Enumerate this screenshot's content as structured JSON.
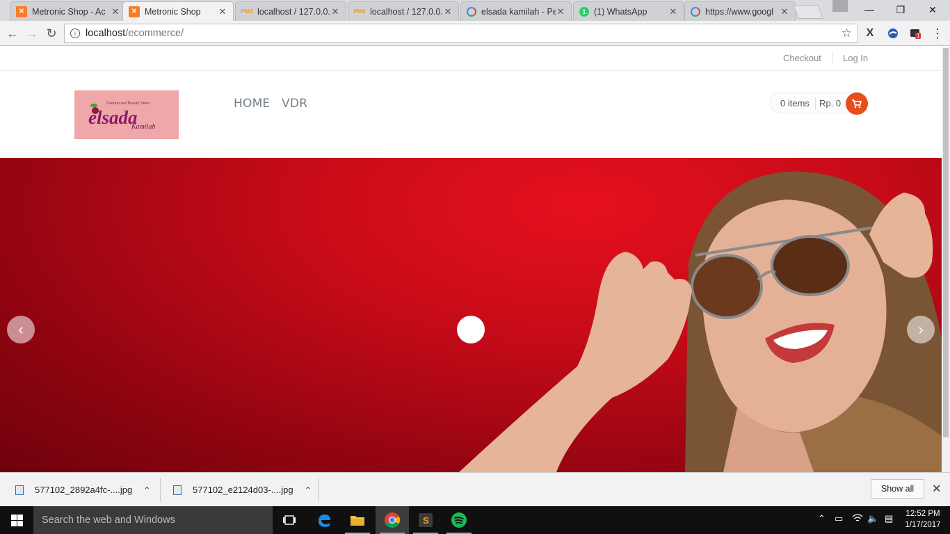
{
  "browser": {
    "tabs": [
      {
        "title": "Metronic Shop - Ac",
        "favicon": "xampp-icon",
        "active": false
      },
      {
        "title": "Metronic Shop",
        "favicon": "xampp-icon",
        "active": true
      },
      {
        "title": "localhost / 127.0.0.",
        "favicon": "phpmyadmin-icon",
        "active": false
      },
      {
        "title": "localhost / 127.0.0.",
        "favicon": "phpmyadmin-icon",
        "active": false
      },
      {
        "title": "elsada kamilah - Pe",
        "favicon": "google-icon",
        "active": false
      },
      {
        "title": "(1) WhatsApp",
        "favicon": "whatsapp-icon",
        "active": false
      },
      {
        "title": "https://www.googl",
        "favicon": "google-icon",
        "active": false
      }
    ],
    "address": {
      "host": "localhost",
      "path": "/ecommerce/"
    },
    "extension_badge": "1"
  },
  "site": {
    "top_links": {
      "checkout": "Checkout",
      "login": "Log In"
    },
    "logo": {
      "text": "elsada",
      "subtext": "Kamilah",
      "tagline": "Fashion and Beauty Store",
      "bg_color": "#eea8aa"
    },
    "nav": [
      {
        "label": "HOME"
      },
      {
        "label": "VDR"
      }
    ],
    "cart": {
      "items": "0 items",
      "total": "Rp. 0",
      "accent": "#e84d1c"
    },
    "slider": {
      "prev": "‹",
      "next": "›",
      "bg_color": "#c70b18"
    }
  },
  "downloads": {
    "files": [
      {
        "name": "577102_2892a4fc-....jpg"
      },
      {
        "name": "577102_e2124d03-....jpg"
      }
    ],
    "show_all": "Show all"
  },
  "taskbar": {
    "search_placeholder": "Search the web and Windows",
    "time": "12:52 PM",
    "date": "1/17/2017"
  }
}
